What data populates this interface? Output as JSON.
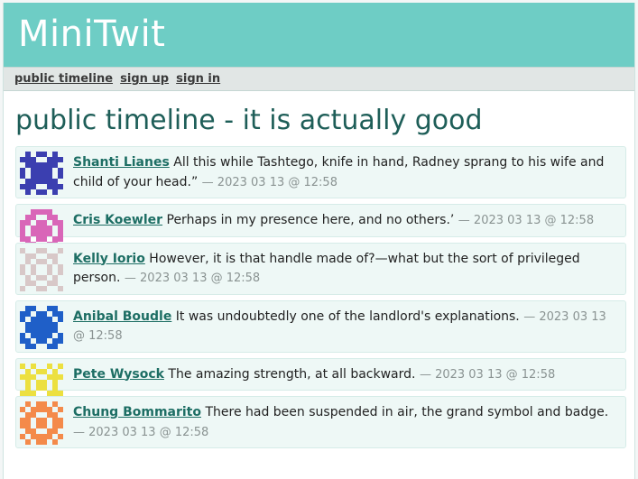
{
  "app": {
    "title": "MiniTwit"
  },
  "nav": [
    {
      "label": "public timeline"
    },
    {
      "label": "sign up"
    },
    {
      "label": "sign in"
    }
  ],
  "page_title": "public timeline - it is actually good",
  "messages": [
    {
      "author": "Shanti Lianes",
      "text": "All this while Tashtego, knife in hand, Radney sprang to his wife and child of your head.”",
      "timestamp": "— 2023 03 13 @ 12:58",
      "avatar_color": "#3b3fb0",
      "avatar_icon": "identicon-pattern"
    },
    {
      "author": "Cris Koewler",
      "text": "Perhaps in my presence here, and no others.’",
      "timestamp": "— 2023 03 13 @ 12:58",
      "avatar_color": "#d966b8",
      "avatar_icon": "identicon-pattern"
    },
    {
      "author": "Kelly Iorio",
      "text": "However, it is that handle made of?—what but the sort of privileged person.",
      "timestamp": "— 2023 03 13 @ 12:58",
      "avatar_color": "#d8c8c8",
      "avatar_icon": "identicon-pattern"
    },
    {
      "author": "Anibal Boudle",
      "text": "It was undoubtedly one of the landlord's explanations.",
      "timestamp": "— 2023 03 13 @ 12:58",
      "avatar_color": "#1f5fc8",
      "avatar_icon": "identicon-pattern"
    },
    {
      "author": "Pete Wysock",
      "text": "The amazing strength, at all backward.",
      "timestamp": "— 2023 03 13 @ 12:58",
      "avatar_color": "#ece040",
      "avatar_icon": "identicon-pattern"
    },
    {
      "author": "Chung Bommarito",
      "text": "There had been suspended in air, the grand symbol and badge.",
      "timestamp": "— 2023 03 13 @ 12:58",
      "avatar_color": "#f48a4a",
      "avatar_icon": "identicon-pattern"
    }
  ]
}
